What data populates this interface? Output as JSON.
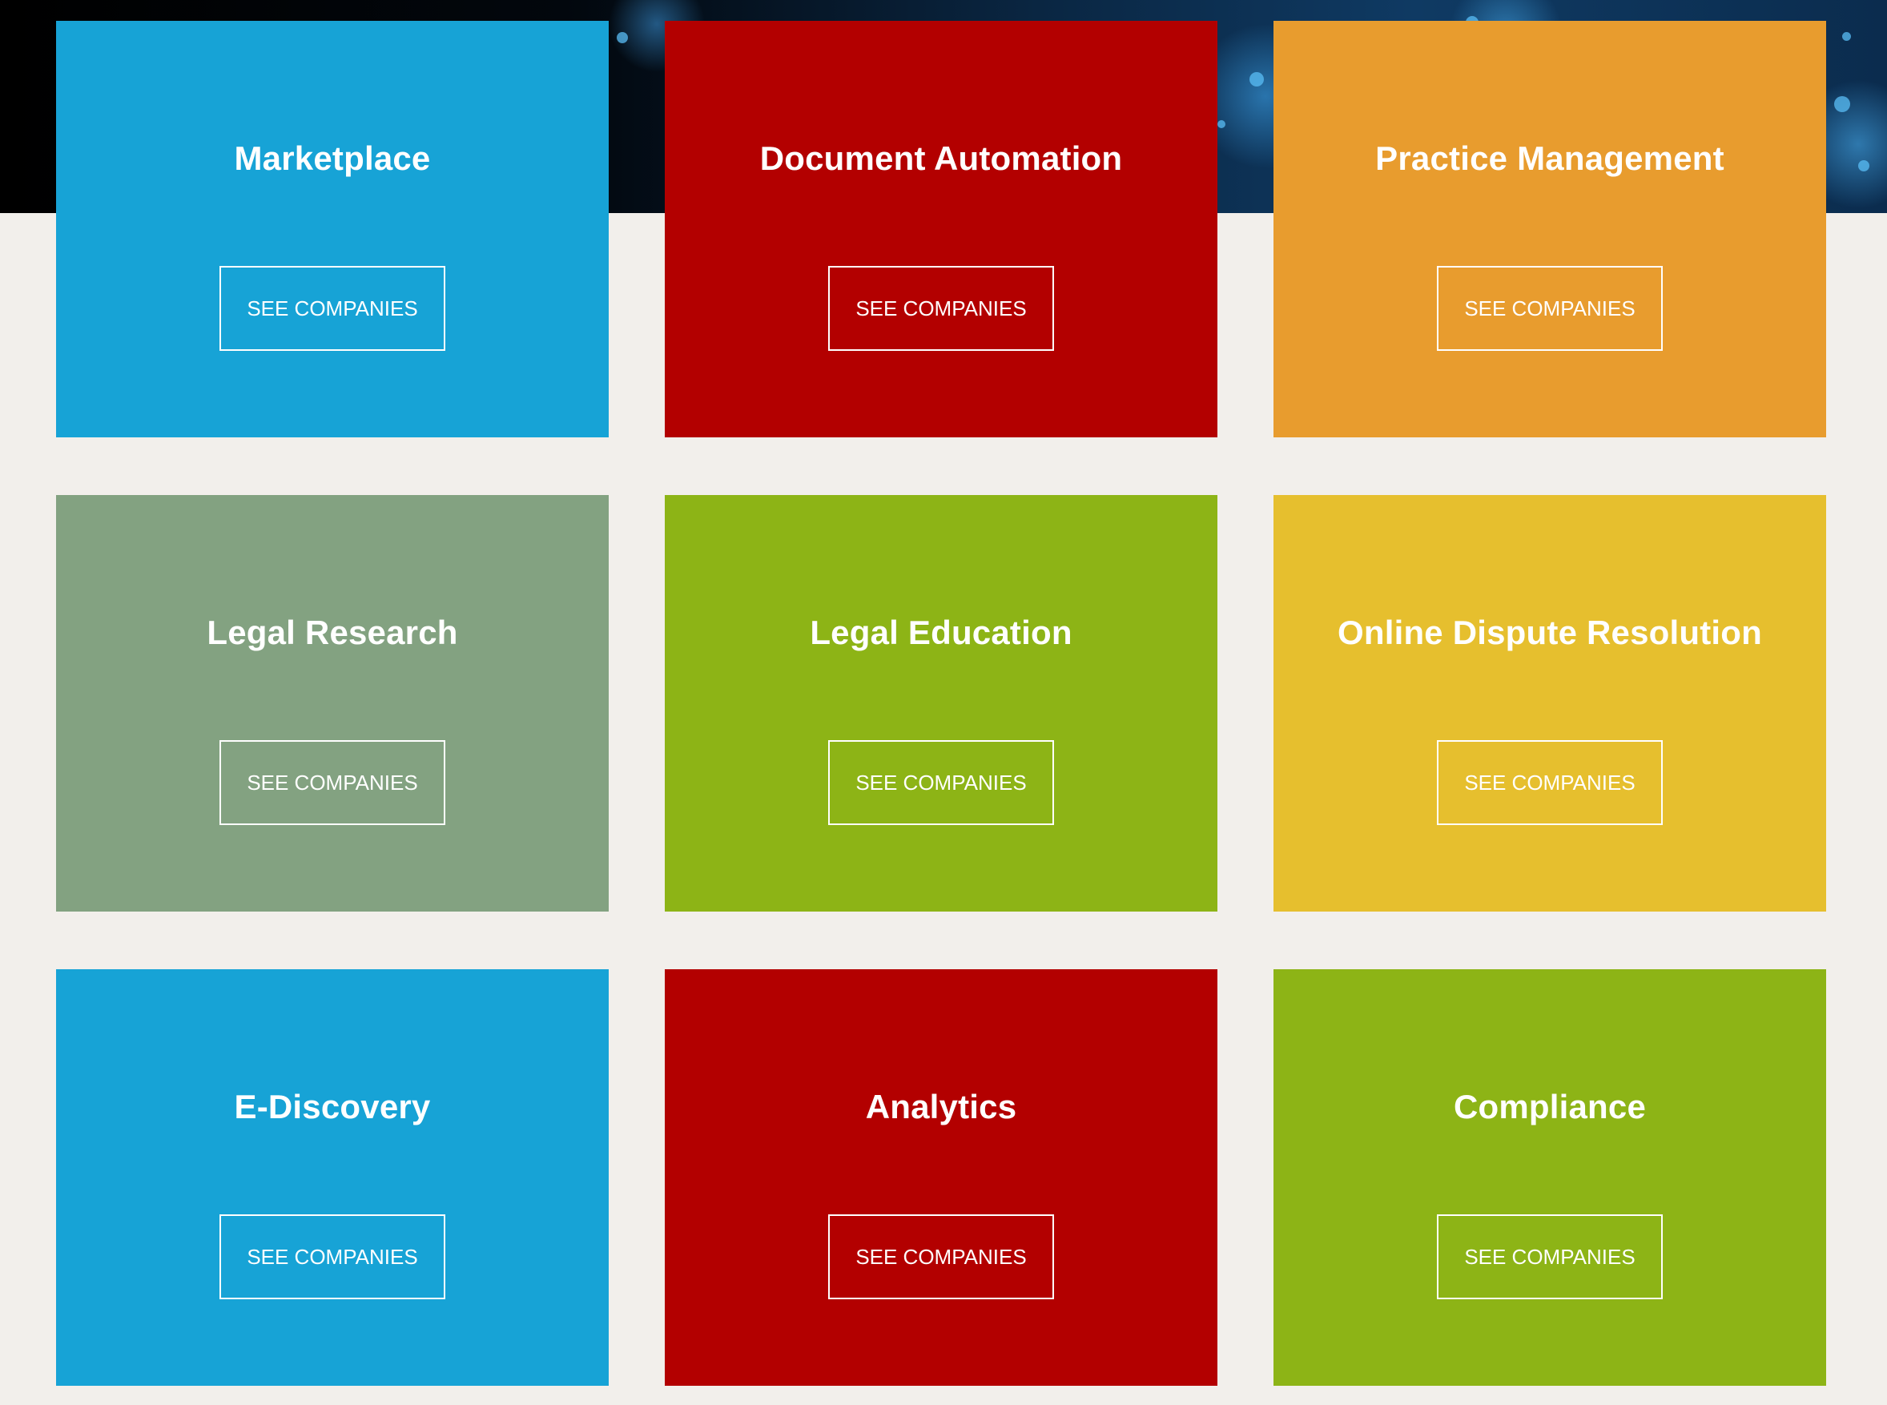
{
  "tiles": [
    {
      "title": "Marketplace",
      "button_label": "SEE COMPANIES",
      "color": "#17a3d6"
    },
    {
      "title": "Document Automation",
      "button_label": "SEE COMPANIES",
      "color": "#b30000"
    },
    {
      "title": "Practice Management",
      "button_label": "SEE COMPANIES",
      "color": "#e89c2e"
    },
    {
      "title": "Legal Research",
      "button_label": "SEE COMPANIES",
      "color": "#83a281"
    },
    {
      "title": "Legal Education",
      "button_label": "SEE COMPANIES",
      "color": "#8db416"
    },
    {
      "title": "Online Dispute Resolution",
      "button_label": "SEE COMPANIES",
      "color": "#e6bf2e"
    },
    {
      "title": "E-Discovery",
      "button_label": "SEE COMPANIES",
      "color": "#17a3d6"
    },
    {
      "title": "Analytics",
      "button_label": "SEE COMPANIES",
      "color": "#b30000"
    },
    {
      "title": "Compliance",
      "button_label": "SEE COMPANIES",
      "color": "#8db416"
    }
  ],
  "colors": {
    "page_background": "#f2efeb",
    "hero_background": "#0b2c4e"
  }
}
